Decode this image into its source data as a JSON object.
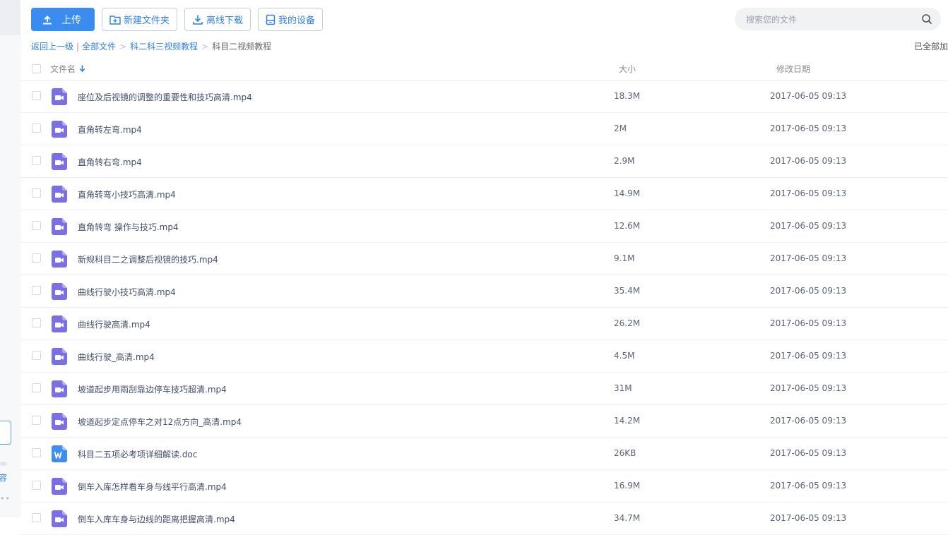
{
  "toolbar": {
    "upload": "上传",
    "new_folder": "新建文件夹",
    "offline_download": "离线下载",
    "my_devices": "我的设备"
  },
  "search": {
    "placeholder": "搜索您的文件"
  },
  "breadcrumb": {
    "back": "返回上一级",
    "separator": "|",
    "all_files": "全部文件",
    "arrow": ">",
    "folder1": "科二科三视频教程",
    "current": "科目二视频教程"
  },
  "status": {
    "loaded": "已全部加"
  },
  "table": {
    "headers": {
      "name": "文件名",
      "size": "大小",
      "date": "修改日期"
    },
    "rows": [
      {
        "name": "座位及后视镜的调整的重要性和技巧高清.mp4",
        "size": "18.3M",
        "date": "2017-06-05 09:13",
        "type": "video-icon"
      },
      {
        "name": "直角转左弯.mp4",
        "size": "2M",
        "date": "2017-06-05 09:13",
        "type": "video-icon"
      },
      {
        "name": "直角转右弯.mp4",
        "size": "2.9M",
        "date": "2017-06-05 09:13",
        "type": "video-icon"
      },
      {
        "name": "直角转弯小技巧高清.mp4",
        "size": "14.9M",
        "date": "2017-06-05 09:13",
        "type": "video-icon"
      },
      {
        "name": "直角转弯 操作与技巧.mp4",
        "size": "12.6M",
        "date": "2017-06-05 09:13",
        "type": "video-icon"
      },
      {
        "name": "新规科目二之调整后视镜的技巧.mp4",
        "size": "9.1M",
        "date": "2017-06-05 09:13",
        "type": "video-icon"
      },
      {
        "name": "曲线行驶小技巧高清.mp4",
        "size": "35.4M",
        "date": "2017-06-05 09:13",
        "type": "video-icon"
      },
      {
        "name": "曲线行驶高清.mp4",
        "size": "26.2M",
        "date": "2017-06-05 09:13",
        "type": "video-icon"
      },
      {
        "name": "曲线行驶_高清.mp4",
        "size": "4.5M",
        "date": "2017-06-05 09:13",
        "type": "video-icon"
      },
      {
        "name": "坡道起步用雨刮靠边停车技巧超清.mp4",
        "size": "31M",
        "date": "2017-06-05 09:13",
        "type": "video-icon"
      },
      {
        "name": "坡道起步定点停车之对12点方向_高清.mp4",
        "size": "14.2M",
        "date": "2017-06-05 09:13",
        "type": "video-icon"
      },
      {
        "name": "科目二五项必考项详细解读.doc",
        "size": "26KB",
        "date": "2017-06-05 09:13",
        "type": "word-doc-icon"
      },
      {
        "name": "倒车入库怎样看车身与线平行高清.mp4",
        "size": "16.9M",
        "date": "2017-06-05 09:13",
        "type": "video-icon"
      },
      {
        "name": "倒车入库车身与边线的距离把握高清.mp4",
        "size": "34.7M",
        "date": "2017-06-05 09:13",
        "type": "video-icon"
      }
    ]
  },
  "sidebar": {
    "partial_text": "容",
    "dots": "••"
  },
  "colors": {
    "accent": "#3b8cf0",
    "link": "#2f7fe8",
    "video_icon": "#7b6fe8",
    "word_icon": "#3d8ef0"
  }
}
